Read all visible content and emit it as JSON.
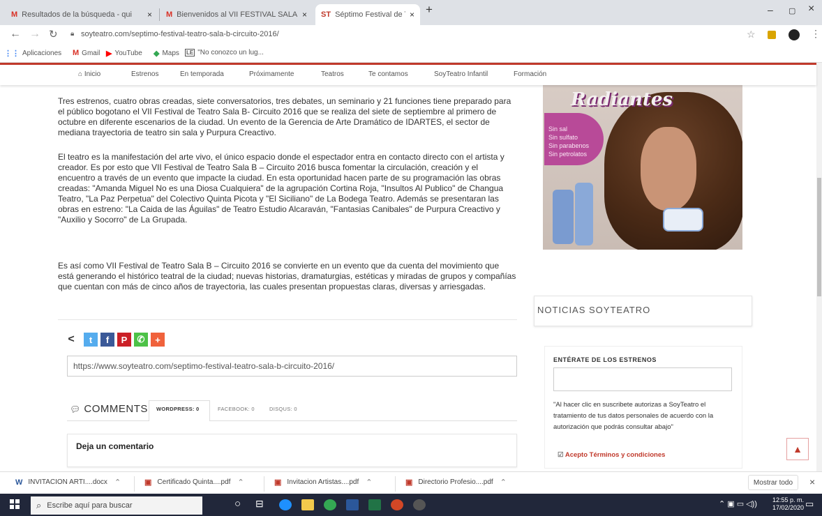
{
  "browser": {
    "tabs": [
      {
        "favicon": "M",
        "title": "Resultados de la búsqueda - qui",
        "close": "×"
      },
      {
        "favicon": "M",
        "title": "Bienvenidos al VII FESTIVAL SALA",
        "close": "×"
      },
      {
        "favicon": "ST",
        "title": "Séptimo Festival de Teatro Sala",
        "close": "×"
      }
    ],
    "new_tab": "+",
    "window_controls": {
      "minimize": "–",
      "maximize": "▢",
      "close": "×"
    },
    "url": "soyteatro.com/septimo-festival-teatro-sala-b-circuito-2016/",
    "bookmarks": [
      {
        "icon": "apps-grid-icon",
        "label": "Aplicaciones"
      },
      {
        "icon": "gmail-icon",
        "label": "Gmail"
      },
      {
        "icon": "youtube-icon",
        "label": "YouTube"
      },
      {
        "icon": "maps-icon",
        "label": "Maps"
      },
      {
        "icon": "le-icon",
        "label": "\"No conozco un lug..."
      }
    ]
  },
  "site_nav": {
    "items": [
      "Inicio",
      "Estrenos",
      "En temporada",
      "Próximamente",
      "Teatros",
      "Te contamos",
      "SoyTeatro Infantil",
      "Formación"
    ]
  },
  "article": {
    "p1": "Tres estrenos, cuatro obras creadas, siete conversatorios, tres debates, un seminario y 21 funciones tiene preparado para el público bogotano el VII Festival de Teatro Sala B- Circuito 2016 que se realiza del siete de septiembre al primero de octubre en diferente escenarios de la ciudad. Un evento de la Gerencia de Arte Dramático de IDARTES, el sector de mediana trayectoria de teatro sin sala y Purpura Creactivo.",
    "p2": "El teatro es la manifestación del arte vivo, el único espacio donde el espectador entra en contacto directo con el artista y creador. Es por esto que VII Festival de Teatro Sala B – Circuito 2016 busca fomentar la circulación, creación y el encuentro a través de un evento que impacte la ciudad. En esta oportunidad hacen parte de su programación las obras creadas: \"Amanda Miguel No es una Diosa Cualquiera\" de la agrupación Cortina Roja, \"Insultos Al Publico\" de Changua Teatro, \"La Paz Perpetua\" del Colectivo Quinta Picota y \"El Siciliano\" de La Bodega Teatro. Además se presentaran las obras en estreno: \"La Caida de las Águilas\" de Teatro Estudio Alcaraván, \"Fantasias Canibales\" de Purpura Creactivo y \"Auxilio y Socorro\" de La Grupada.",
    "p3": "Es así como VII Festival de Teatro Sala B – Circuito 2016 se convierte en un evento que da cuenta del movimiento que está generando el histórico teatral de la ciudad; nuevas historias, dramaturgias, estéticas y miradas de grupos y compañías que cuentan con más de cinco años de trayectoria, las cuales presentan propuestas claras, diversas y arriesgadas.",
    "share_url": "https://www.soyteatro.com/septimo-festival-teatro-sala-b-circuito-2016/"
  },
  "share": {
    "buttons": [
      {
        "icon": "share-icon",
        "glyph": "<"
      },
      {
        "icon": "twitter-icon",
        "glyph": "t",
        "color": "#55acee"
      },
      {
        "icon": "facebook-icon",
        "glyph": "f",
        "color": "#3b5998"
      },
      {
        "icon": "pinterest-icon",
        "glyph": "P",
        "color": "#cb2027"
      },
      {
        "icon": "whatsapp-icon",
        "glyph": "✆",
        "color": "#4dc247"
      },
      {
        "icon": "more-icon",
        "glyph": "+",
        "color": "#f0623c"
      }
    ]
  },
  "comments": {
    "title": "COMMENTS",
    "tabs": [
      "WORDPRESS: 0",
      "FACEBOOK: 0",
      "DISQUS: 0"
    ],
    "leave_comment": "Deja un comentario"
  },
  "ad": {
    "title": "Radiantes",
    "lines": [
      "Sin sal",
      "Sin sulfato",
      "Sin parabenos",
      "Sin petrolatos"
    ]
  },
  "sidebar": {
    "news_title": "NOTICIAS SOYTEATRO",
    "newsletter_title": "ENTÉRATE DE LOS ESTRENOS",
    "newsletter_text": "\"Al hacer clic en suscribete autorizas a SoyTeatro el tratamiento de tus datos personales de acuerdo con la autorización que podrás consultar abajo\"",
    "terms": "Acepto Términos y condiciones"
  },
  "downloads": {
    "items": [
      "INVITACION ARTI....docx",
      "Certificado Quinta....pdf",
      "Invitacion Artistas....pdf",
      "Directorio Profesio....pdf"
    ],
    "show_all": "Mostrar todo",
    "close": "×"
  },
  "taskbar": {
    "search_placeholder": "Escribe aquí para buscar",
    "time": "12:55 p. m.",
    "date": "17/02/2020"
  },
  "colors": {
    "accent": "#c0392b",
    "taskbar": "#21273a",
    "tabstrip": "#dee1e6"
  }
}
